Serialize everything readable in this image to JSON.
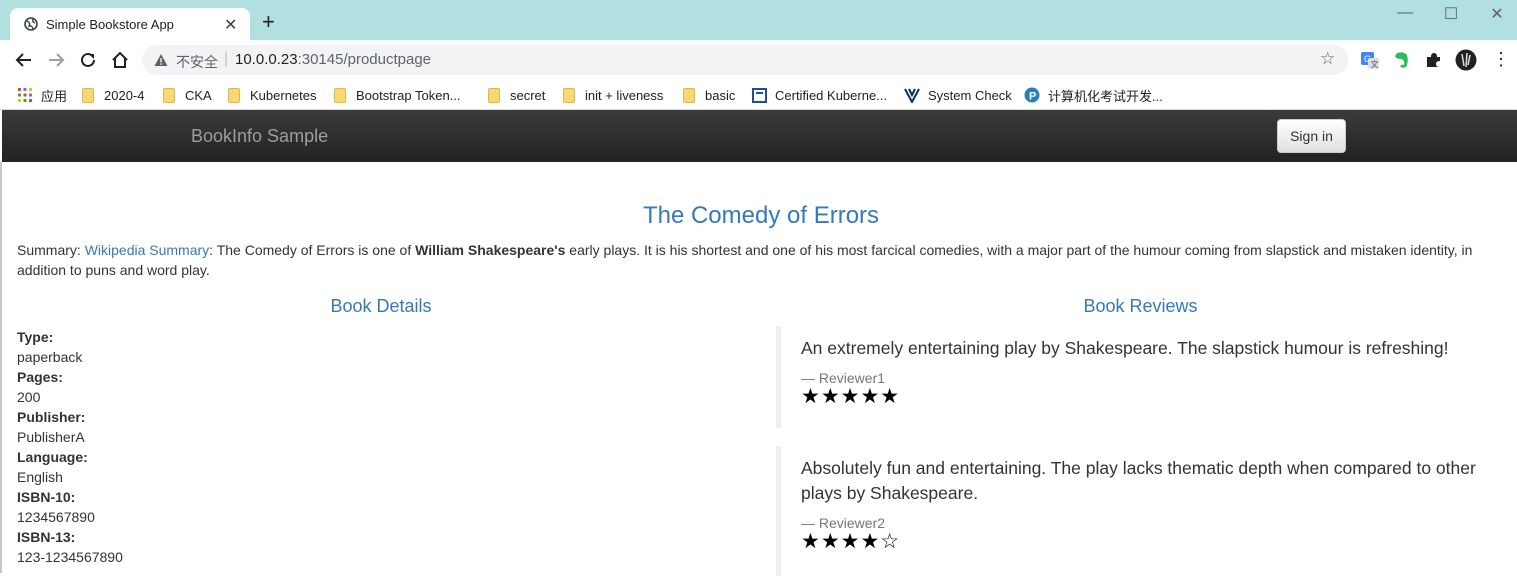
{
  "browser": {
    "tab_title": "Simple Bookstore App",
    "insecure_label": "不安全",
    "url_host": "10.0.0.23",
    "url_port_path": ":30145/productpage",
    "bookmarks": [
      {
        "label": "应用",
        "icon": "apps-grid-icon"
      },
      {
        "label": "2020-4",
        "icon": "folder-icon"
      },
      {
        "label": "CKA",
        "icon": "folder-icon"
      },
      {
        "label": "Kubernetes",
        "icon": "folder-icon"
      },
      {
        "label": "Bootstrap Token...",
        "icon": "folder-icon"
      },
      {
        "label": "secret",
        "icon": "folder-icon"
      },
      {
        "label": "init + liveness",
        "icon": "folder-icon"
      },
      {
        "label": "basic",
        "icon": "folder-icon"
      },
      {
        "label": "Certified Kuberne...",
        "icon": "page-icon"
      },
      {
        "label": "System Check",
        "icon": "v-logo-icon"
      },
      {
        "label": "计算机化考试开发...",
        "icon": "p-logo-icon"
      }
    ]
  },
  "app": {
    "brand": "BookInfo Sample",
    "signin_label": "Sign in"
  },
  "book": {
    "title": "The Comedy of Errors",
    "summary_label": "Summary:",
    "summary_link": "Wikipedia Summary",
    "summary_text_1": ": The Comedy of Errors is one of ",
    "summary_author": "William Shakespeare's",
    "summary_text_2": " early plays. It is his shortest and one of his most farcical comedies, with a major part of the humour coming from slapstick and mistaken identity, in addition to puns and word play."
  },
  "details": {
    "heading": "Book Details",
    "items": [
      {
        "key": "Type:",
        "value": "paperback"
      },
      {
        "key": "Pages:",
        "value": "200"
      },
      {
        "key": "Publisher:",
        "value": "PublisherA"
      },
      {
        "key": "Language:",
        "value": "English"
      },
      {
        "key": "ISBN-10:",
        "value": "1234567890"
      },
      {
        "key": "ISBN-13:",
        "value": "123-1234567890"
      }
    ]
  },
  "reviews": {
    "heading": "Book Reviews",
    "items": [
      {
        "text": "An extremely entertaining play by Shakespeare. The slapstick humour is refreshing!",
        "reviewer": "— Reviewer1",
        "stars": "★★★★★",
        "rating": 5
      },
      {
        "text": "Absolutely fun and entertaining. The play lacks thematic depth when compared to other plays by Shakespeare.",
        "reviewer": "— Reviewer2",
        "stars": "★★★★☆",
        "rating": 4
      }
    ]
  },
  "colors": {
    "tabbar": "#b2dfdf",
    "link": "#337ab7",
    "navbar": "#222222"
  }
}
